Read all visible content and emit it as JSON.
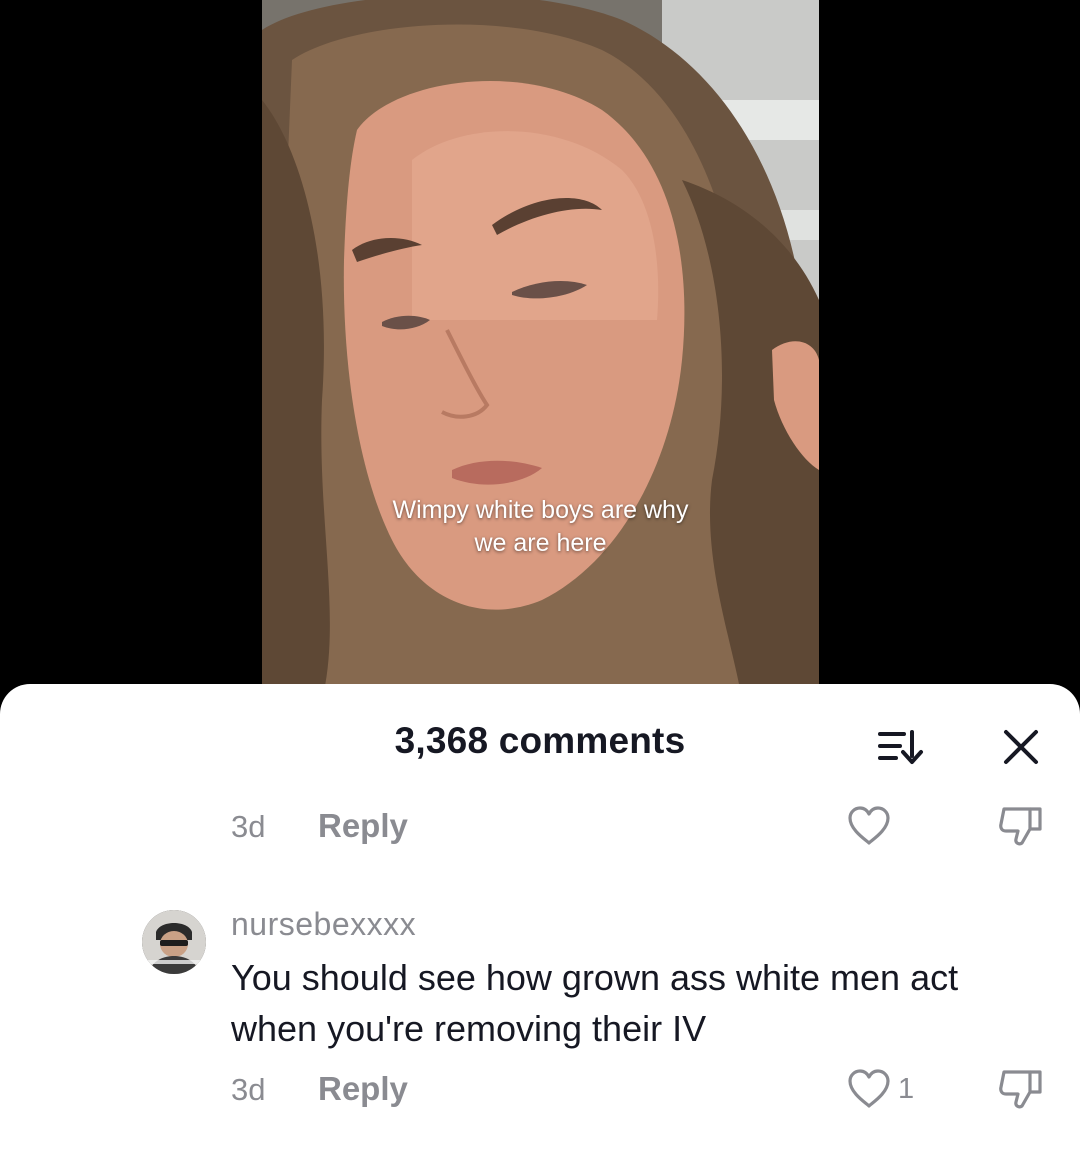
{
  "video": {
    "caption_lines": [
      "Wimpy white boys are why",
      "we are here"
    ]
  },
  "comments_panel": {
    "title": "3,368 comments",
    "sort_icon": "sort-icon",
    "close_icon": "close-icon"
  },
  "previous_comment": {
    "time": "3d",
    "reply_label": "Reply",
    "like_count": ""
  },
  "comment": {
    "username": "nursebexxxx",
    "text": "You should see how grown ass white men act when you're removing their IV",
    "time": "3d",
    "reply_label": "Reply",
    "like_count": "1"
  },
  "colors": {
    "text_primary": "#161823",
    "text_secondary": "#8a8b91",
    "sheet_background": "#ffffff",
    "backdrop": "#000000"
  }
}
